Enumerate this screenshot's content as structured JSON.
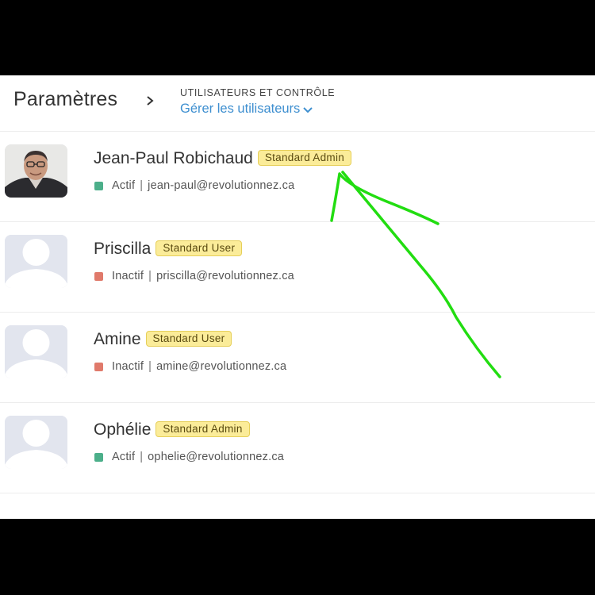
{
  "header": {
    "title": "Paramètres",
    "section_label": "UTILISATEURS ET CONTRÔLE",
    "section_link": "Gérer les utilisateurs"
  },
  "users": [
    {
      "name": "Jean-Paul Robichaud",
      "role": "Standard Admin",
      "status": "Actif",
      "email": "jean-paul@revolutionnez.ca",
      "status_color": "#4caf8a",
      "avatar": "photo"
    },
    {
      "name": "Priscilla",
      "role": "Standard User",
      "status": "Inactif",
      "email": "priscilla@revolutionnez.ca",
      "status_color": "#e07a6b",
      "avatar": "placeholder"
    },
    {
      "name": "Amine",
      "role": "Standard User",
      "status": "Inactif",
      "email": "amine@revolutionnez.ca",
      "status_color": "#e07a6b",
      "avatar": "placeholder"
    },
    {
      "name": "Ophélie",
      "role": "Standard Admin",
      "status": "Actif",
      "email": "ophelie@revolutionnez.ca",
      "status_color": "#4caf8a",
      "avatar": "placeholder"
    }
  ],
  "colors": {
    "accent": "#3e8fd0",
    "badge_bg": "#fbec99",
    "annotation_arrow": "#22dd11"
  }
}
